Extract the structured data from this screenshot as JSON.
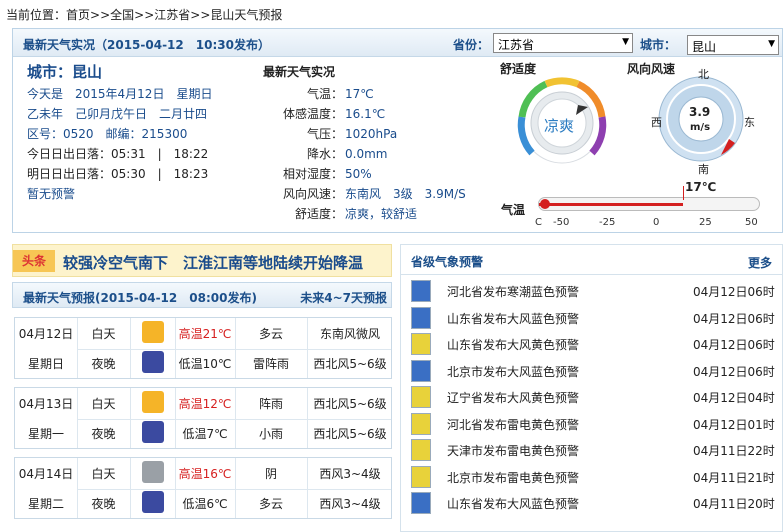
{
  "breadcrumb": {
    "prefix": "当前位置：",
    "items": [
      "首页",
      "全国",
      "江苏省",
      "昆山天气预报"
    ],
    "sep": ">>"
  },
  "header": {
    "title": "最新天气实况（2015-04-12　10:30发布）",
    "province_label": "省份：",
    "province_value": "江苏省",
    "city_label": "城市：",
    "city_value": "昆山"
  },
  "city_info": {
    "name": "城市：昆山",
    "date": "今天是　2015年4月12日　星期日",
    "lunar": "乙未年　己卯月戊午日　二月廿四",
    "code": "区号：0520　邮编：215300",
    "sun_today": "今日日出日落：05:31　|　18:22",
    "sun_tomorrow": "明日日出日落：05:30　|　18:23",
    "alert": "暂无预警"
  },
  "observation": {
    "title": "最新天气实况",
    "rows": [
      {
        "k": "气温：",
        "v": "17℃"
      },
      {
        "k": "体感温度：",
        "v": "16.1℃"
      },
      {
        "k": "气压：",
        "v": "1020hPa"
      },
      {
        "k": "降水：",
        "v": "0.0mm"
      },
      {
        "k": "相对湿度：",
        "v": "50%"
      },
      {
        "k": "风向风速：",
        "v": "东南风　3级　3.9M/S"
      },
      {
        "k": "舒适度：",
        "v": "凉爽，较舒适"
      }
    ]
  },
  "comfort": {
    "title": "舒适度",
    "value": "凉爽"
  },
  "wind": {
    "title": "风向风速",
    "speed": "3.9",
    "unit": "m/s",
    "n": "北",
    "s": "南",
    "e": "东",
    "w": "西"
  },
  "temp_bar": {
    "title": "气温",
    "value_label": "17℃",
    "value": 17,
    "ticks": [
      "C",
      "-50",
      "-25",
      "0",
      "25",
      "50"
    ],
    "min": -50,
    "max": 50
  },
  "headline": {
    "tag": "头条",
    "text": "较强冷空气南下　江淮江南等地陆续开始降温"
  },
  "forecast": {
    "title": "最新天气预报(2015-04-12　08:00发布)",
    "more": "未来4~7天预报",
    "days": [
      {
        "date": "04月12日",
        "weekday": "星期日",
        "day": {
          "label": "白天",
          "temp": "高温21℃",
          "weather": "多云",
          "wind": "东南风微风",
          "icon": "partly-cloudy-icon"
        },
        "night": {
          "label": "夜晚",
          "temp": "低温10℃",
          "weather": "雷阵雨",
          "wind": "西北风5~6级",
          "icon": "thunderstorm-icon"
        }
      },
      {
        "date": "04月13日",
        "weekday": "星期一",
        "day": {
          "label": "白天",
          "temp": "高温12℃",
          "weather": "阵雨",
          "wind": "西北风5~6级",
          "icon": "shower-icon"
        },
        "night": {
          "label": "夜晚",
          "temp": "低温7℃",
          "weather": "小雨",
          "wind": "西北风5~6级",
          "icon": "light-rain-icon"
        }
      },
      {
        "date": "04月14日",
        "weekday": "星期二",
        "day": {
          "label": "白天",
          "temp": "高温16℃",
          "weather": "阴",
          "wind": "西风3~4级",
          "icon": "overcast-icon"
        },
        "night": {
          "label": "夜晚",
          "temp": "低温6℃",
          "weather": "多云",
          "wind": "西风3~4级",
          "icon": "moon-cloud-icon"
        }
      }
    ]
  },
  "warnings": {
    "title": "省级气象预警",
    "more": "更多",
    "items": [
      {
        "text": "河北省发布寒潮蓝色预警",
        "date": "04月12日06时",
        "color": "#3a6fc4"
      },
      {
        "text": "山东省发布大风蓝色预警",
        "date": "04月12日06时",
        "color": "#3a6fc4"
      },
      {
        "text": "山东省发布大风黄色预警",
        "date": "04月12日06时",
        "color": "#e8d23a"
      },
      {
        "text": "北京市发布大风蓝色预警",
        "date": "04月12日06时",
        "color": "#3a6fc4"
      },
      {
        "text": "辽宁省发布大风黄色预警",
        "date": "04月12日04时",
        "color": "#e8d23a"
      },
      {
        "text": "河北省发布雷电黄色预警",
        "date": "04月12日01时",
        "color": "#e8d23a"
      },
      {
        "text": "天津市发布雷电黄色预警",
        "date": "04月11日22时",
        "color": "#e8d23a"
      },
      {
        "text": "北京市发布雷电黄色预警",
        "date": "04月11日21时",
        "color": "#e8d23a"
      },
      {
        "text": "山东省发布大风蓝色预警",
        "date": "04月11日20时",
        "color": "#3a6fc4"
      }
    ]
  }
}
